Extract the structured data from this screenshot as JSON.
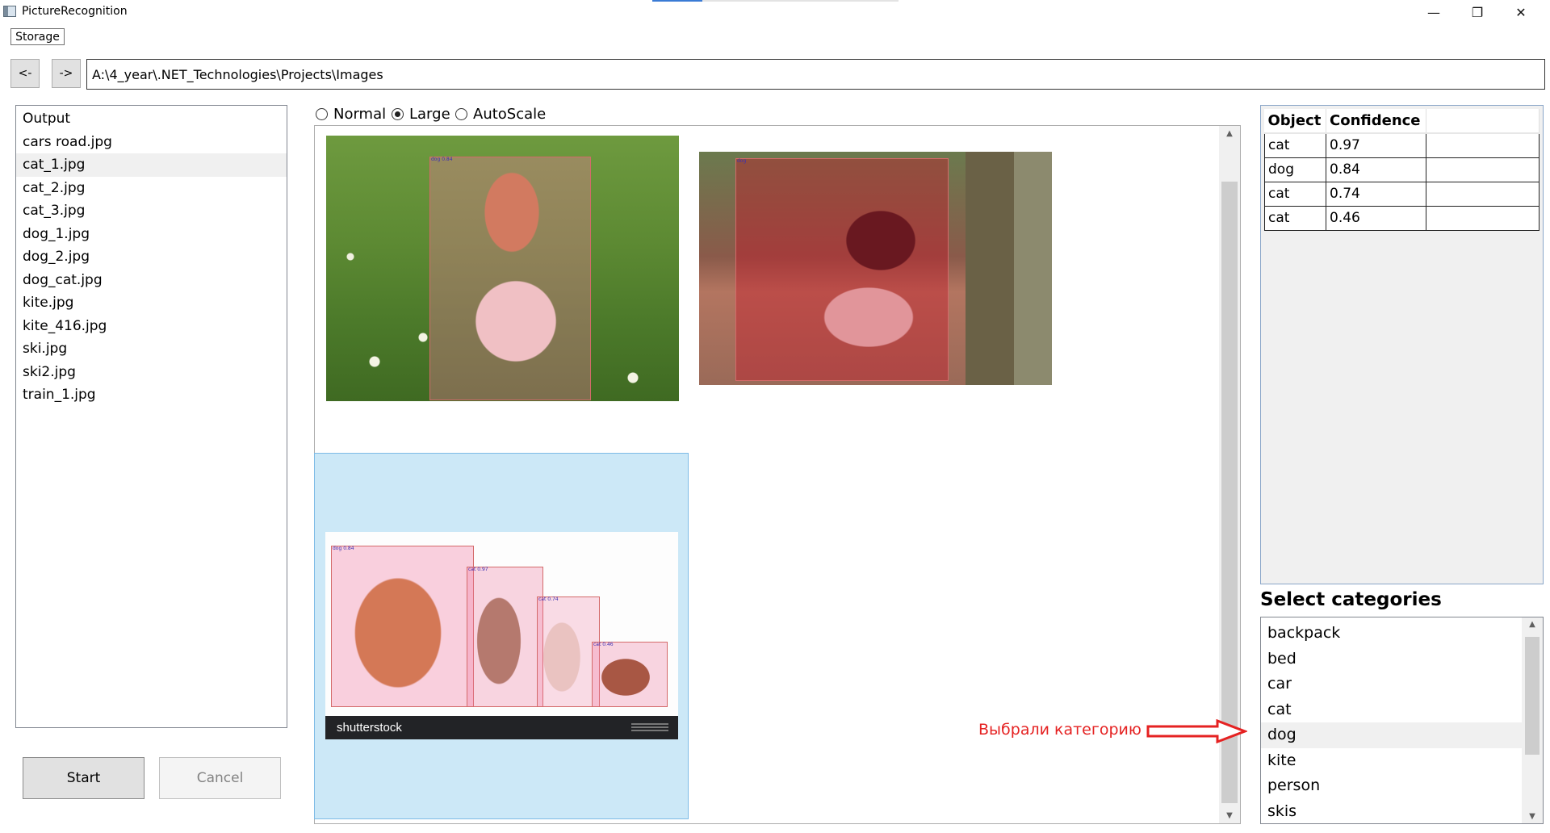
{
  "window": {
    "title": "PictureRecognition",
    "minimize_glyph": "—",
    "maximize_glyph": "❐",
    "close_glyph": "✕"
  },
  "menu": {
    "storage_label": "Storage"
  },
  "nav": {
    "back_label": "<-",
    "forward_label": "->",
    "path": "A:\\4_year\\.NET_Technologies\\Projects\\Images"
  },
  "files": [
    "Output",
    "cars road.jpg",
    "cat_1.jpg",
    "cat_2.jpg",
    "cat_3.jpg",
    "dog_1.jpg",
    "dog_2.jpg",
    "dog_cat.jpg",
    "kite.jpg",
    "kite_416.jpg",
    "ski.jpg",
    "ski2.jpg",
    "train_1.jpg"
  ],
  "selected_file": "cat_1.jpg",
  "actions": {
    "start_label": "Start",
    "cancel_label": "Cancel"
  },
  "view_modes": {
    "options": [
      "Normal",
      "Large",
      "AutoScale"
    ],
    "selected": "Large"
  },
  "images": [
    {
      "boxes": [
        {
          "label": "dog 0.84"
        }
      ]
    },
    {
      "boxes": [
        {
          "label": "dog"
        }
      ]
    },
    {
      "footer": "shutterstock",
      "boxes": [
        {
          "label": "dog 0.84"
        },
        {
          "label": "cat 0.97"
        },
        {
          "label": "cat 0.74"
        },
        {
          "label": "cat 0.46"
        }
      ]
    }
  ],
  "results": {
    "headers": [
      "Object",
      "Confidence",
      ""
    ],
    "rows": [
      [
        "cat",
        "0.97",
        ""
      ],
      [
        "dog",
        "0.84",
        ""
      ],
      [
        "cat",
        "0.74",
        ""
      ],
      [
        "cat",
        "0.46",
        ""
      ]
    ]
  },
  "categories": {
    "title": "Select categories",
    "items": [
      "backpack",
      "bed",
      "car",
      "cat",
      "dog",
      "kite",
      "person",
      "skis"
    ],
    "selected": "dog"
  },
  "annotation": {
    "text": "Выбрали категорию",
    "color": "#e52222"
  }
}
